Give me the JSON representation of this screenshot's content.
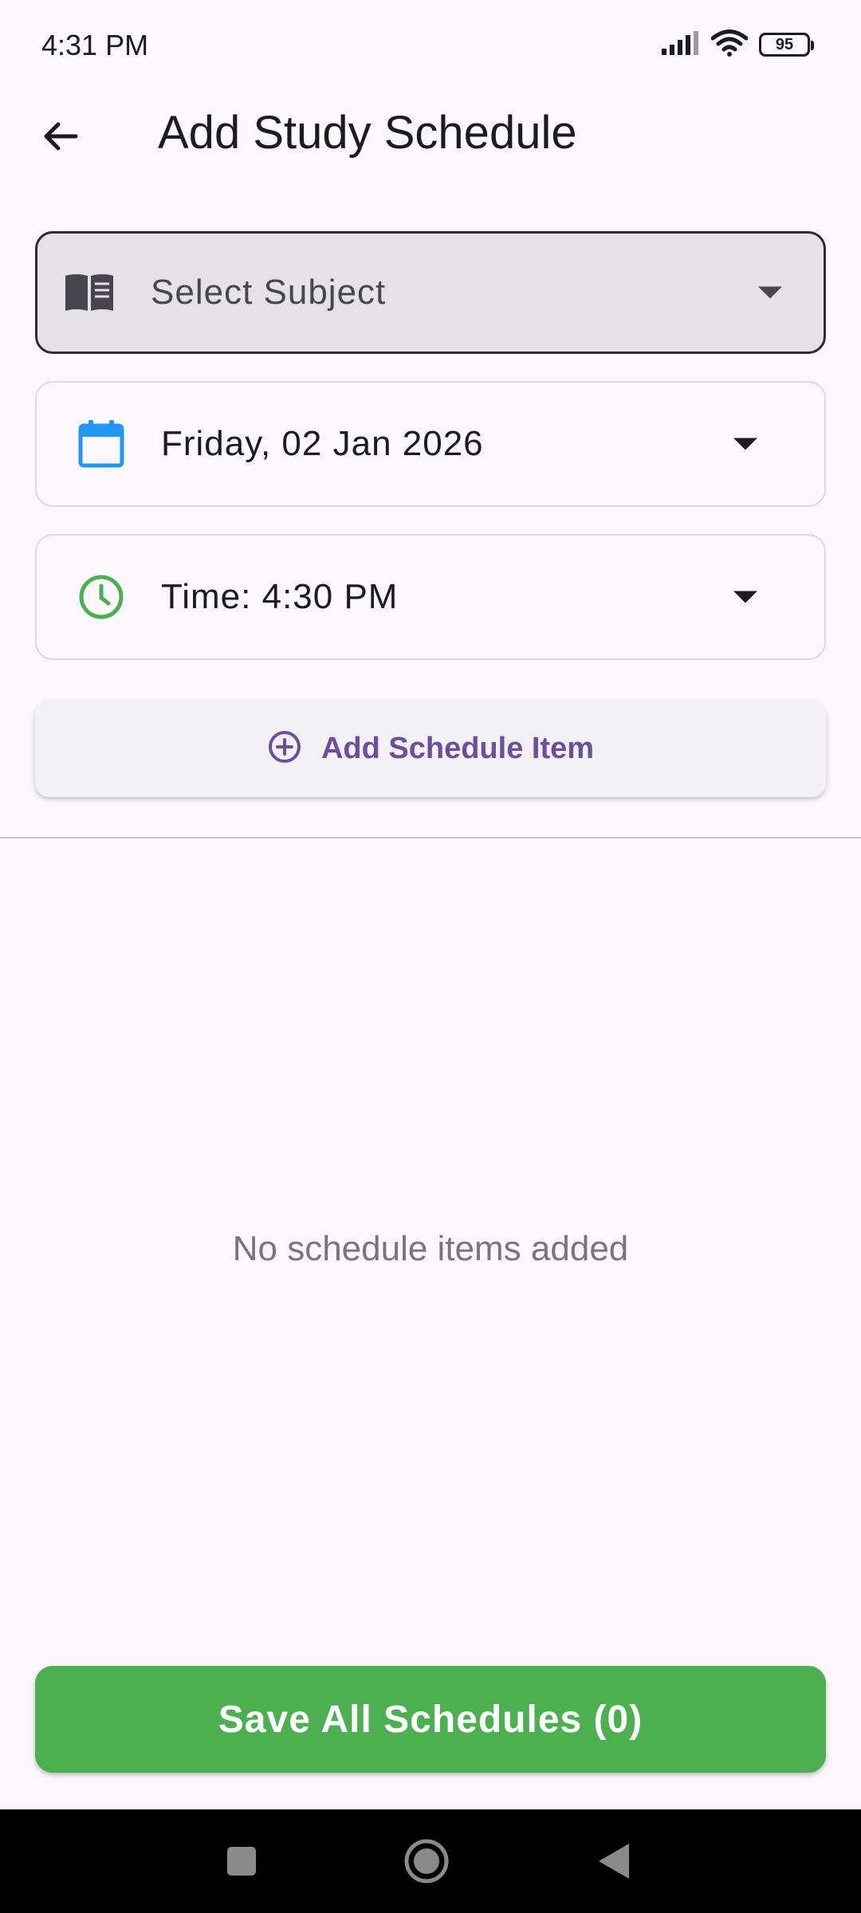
{
  "status_bar": {
    "time": "4:31 PM",
    "battery": "95",
    "icons": [
      "signal-icon",
      "wifi-icon",
      "battery-icon"
    ]
  },
  "app_bar": {
    "title": "Add Study Schedule",
    "back_icon": "arrow-back-icon"
  },
  "form": {
    "subject": {
      "placeholder": "Select Subject",
      "icon": "book-icon"
    },
    "date": {
      "value": "Friday, 02 Jan 2026",
      "icon": "calendar-icon"
    },
    "time": {
      "value": "Time: 4:30 PM",
      "icon": "clock-icon"
    },
    "add_button": {
      "label": "Add Schedule Item",
      "icon": "add-circle-icon"
    }
  },
  "list": {
    "empty_message": "No schedule items added"
  },
  "save_button": {
    "label": "Save All Schedules (0)"
  },
  "colors": {
    "accent": "#6a4f9c",
    "save": "#4caf50",
    "calendar": "#2196f3",
    "clock": "#4caf50"
  }
}
